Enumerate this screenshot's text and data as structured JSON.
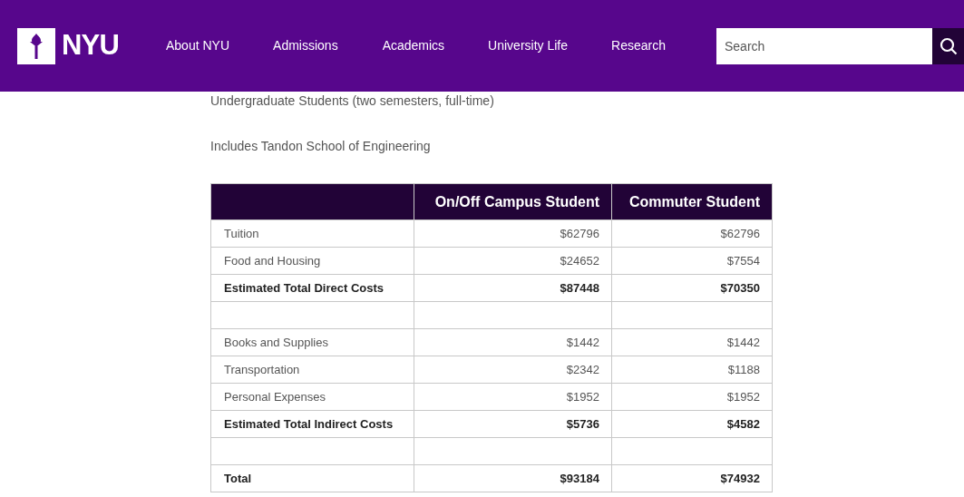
{
  "header": {
    "logo": "NYU",
    "nav": [
      "About NYU",
      "Admissions",
      "Academics",
      "University Life",
      "Research"
    ],
    "search": {
      "placeholder": "Search"
    }
  },
  "intro": [
    "Undergraduate Students (two semesters, full-time)",
    "Includes Tandon School of Engineering"
  ],
  "table": {
    "columns": [
      "On/Off Campus Student",
      "Commuter Student"
    ],
    "rows": [
      {
        "kind": "item",
        "label": "Tuition",
        "values": [
          "$62796",
          "$62796"
        ]
      },
      {
        "kind": "item",
        "label": "Food and Housing",
        "values": [
          "$24652",
          "$7554"
        ]
      },
      {
        "kind": "subtotal",
        "label": "Estimated Total Direct Costs",
        "values": [
          "$87448",
          "$70350"
        ]
      },
      {
        "kind": "spacer"
      },
      {
        "kind": "item",
        "label": "Books and Supplies",
        "values": [
          "$1442",
          "$1442"
        ]
      },
      {
        "kind": "item",
        "label": "Transportation",
        "values": [
          "$2342",
          "$1188"
        ]
      },
      {
        "kind": "item",
        "label": "Personal Expenses",
        "values": [
          "$1952",
          "$1952"
        ]
      },
      {
        "kind": "subtotal",
        "label": "Estimated Total Indirect Costs",
        "values": [
          "$5736",
          "$4582"
        ]
      },
      {
        "kind": "spacer"
      },
      {
        "kind": "subtotal",
        "label": "Total",
        "values": [
          "$93184",
          "$74932"
        ]
      }
    ]
  }
}
